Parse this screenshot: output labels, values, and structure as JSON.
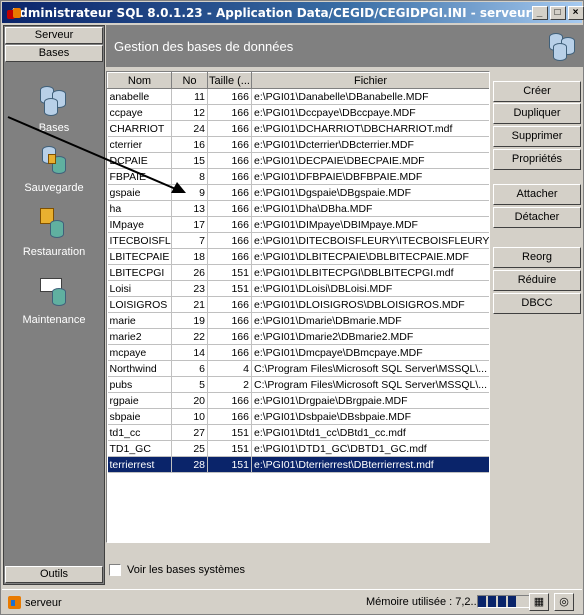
{
  "window": {
    "title": "Administrateur SQL 8.0.1.23 - Application Data/CEGID/CEGIDPGI.INI - serveur",
    "min_label": "_",
    "max_label": "□",
    "close_label": "×"
  },
  "nav": {
    "serveur_label": "Serveur",
    "bases_tab_label": "Bases",
    "outils_label": "Outils",
    "items": [
      {
        "label": "Bases",
        "icon": "databases-icon"
      },
      {
        "label": "Sauvegarde",
        "icon": "backup-icon"
      },
      {
        "label": "Restauration",
        "icon": "restore-icon"
      },
      {
        "label": "Maintenance",
        "icon": "maintenance-icon"
      }
    ]
  },
  "header": {
    "title": "Gestion des bases de données"
  },
  "table": {
    "columns": [
      "Nom",
      "No",
      "Taille (...",
      "Fichier"
    ],
    "rows": [
      [
        "anabelle",
        "11",
        "166",
        "e:\\PGI01\\Danabelle\\DBanabelle.MDF"
      ],
      [
        "ccpaye",
        "12",
        "166",
        "e:\\PGI01\\Dccpaye\\DBccpaye.MDF"
      ],
      [
        "CHARRIOT",
        "24",
        "166",
        "e:\\PGI01\\DCHARRIOT\\DBCHARRIOT.mdf"
      ],
      [
        "cterrier",
        "16",
        "166",
        "e:\\PGI01\\Dcterrier\\DBcterrier.MDF"
      ],
      [
        "DCPAIE",
        "15",
        "166",
        "e:\\PGI01\\DECPAIE\\DBECPAIE.MDF"
      ],
      [
        "FBPAIE",
        "8",
        "166",
        "e:\\PGI01\\DFBPAIE\\DBFBPAIE.MDF"
      ],
      [
        "gspaie",
        "9",
        "166",
        "e:\\PGI01\\Dgspaie\\DBgspaie.MDF"
      ],
      [
        "ha",
        "13",
        "166",
        "e:\\PGI01\\Dha\\DBha.MDF"
      ],
      [
        "IMpaye",
        "17",
        "166",
        "e:\\PGI01\\DIMpaye\\DBIMpaye.MDF"
      ],
      [
        "ITECBOISFL...",
        "7",
        "166",
        "e:\\PGI01\\DITECBOISFLEURY\\ITECBOISFLEURY...."
      ],
      [
        "LBITECPAIE",
        "18",
        "166",
        "e:\\PGI01\\DLBITECPAIE\\DBLBITECPAIE.MDF"
      ],
      [
        "LBITECPGI",
        "26",
        "151",
        "e:\\PGI01\\DLBITECPGI\\DBLBITECPGI.mdf"
      ],
      [
        "Loisi",
        "23",
        "151",
        "e:\\PGI01\\DLoisi\\DBLoisi.MDF"
      ],
      [
        "LOISIGROS",
        "21",
        "166",
        "e:\\PGI01\\DLOISIGROS\\DBLOISIGROS.MDF"
      ],
      [
        "marie",
        "19",
        "166",
        "e:\\PGI01\\Dmarie\\DBmarie.MDF"
      ],
      [
        "marie2",
        "22",
        "166",
        "e:\\PGI01\\Dmarie2\\DBmarie2.MDF"
      ],
      [
        "mcpaye",
        "14",
        "166",
        "e:\\PGI01\\Dmcpaye\\DBmcpaye.MDF"
      ],
      [
        "Northwind",
        "6",
        "4",
        "C:\\Program Files\\Microsoft SQL Server\\MSSQL\\..."
      ],
      [
        "pubs",
        "5",
        "2",
        "C:\\Program Files\\Microsoft SQL Server\\MSSQL\\..."
      ],
      [
        "rgpaie",
        "20",
        "166",
        "e:\\PGI01\\Drgpaie\\DBrgpaie.MDF"
      ],
      [
        "sbpaie",
        "10",
        "166",
        "e:\\PGI01\\Dsbpaie\\DBsbpaie.MDF"
      ],
      [
        "td1_cc",
        "27",
        "151",
        "e:\\PGI01\\Dtd1_cc\\DBtd1_cc.mdf"
      ],
      [
        "TD1_GC",
        "25",
        "151",
        "e:\\PGI01\\DTD1_GC\\DBTD1_GC.mdf"
      ],
      [
        "terrierrest",
        "28",
        "151",
        "e:\\PGI01\\Dterrierrest\\DBterrierrest.mdf"
      ]
    ],
    "selected_row": 23
  },
  "actions": {
    "creer": "Créer",
    "dupliquer": "Dupliquer",
    "supprimer": "Supprimer",
    "proprietes": "Propriétés",
    "attacher": "Attacher",
    "detacher": "Détacher",
    "reorg": "Reorg",
    "reduire": "Réduire",
    "dbcc": "DBCC"
  },
  "options": {
    "show_system_dbs_label": "Voir les bases systèmes",
    "show_system_dbs_checked": false
  },
  "status": {
    "server": "serveur",
    "memory_label": "Mémoire utilisée : 7,2...",
    "memory_level_fraction": 0.68
  },
  "colors": {
    "selection": "#0a246a",
    "panel_dark": "#808080",
    "face": "#d4d0c8"
  }
}
